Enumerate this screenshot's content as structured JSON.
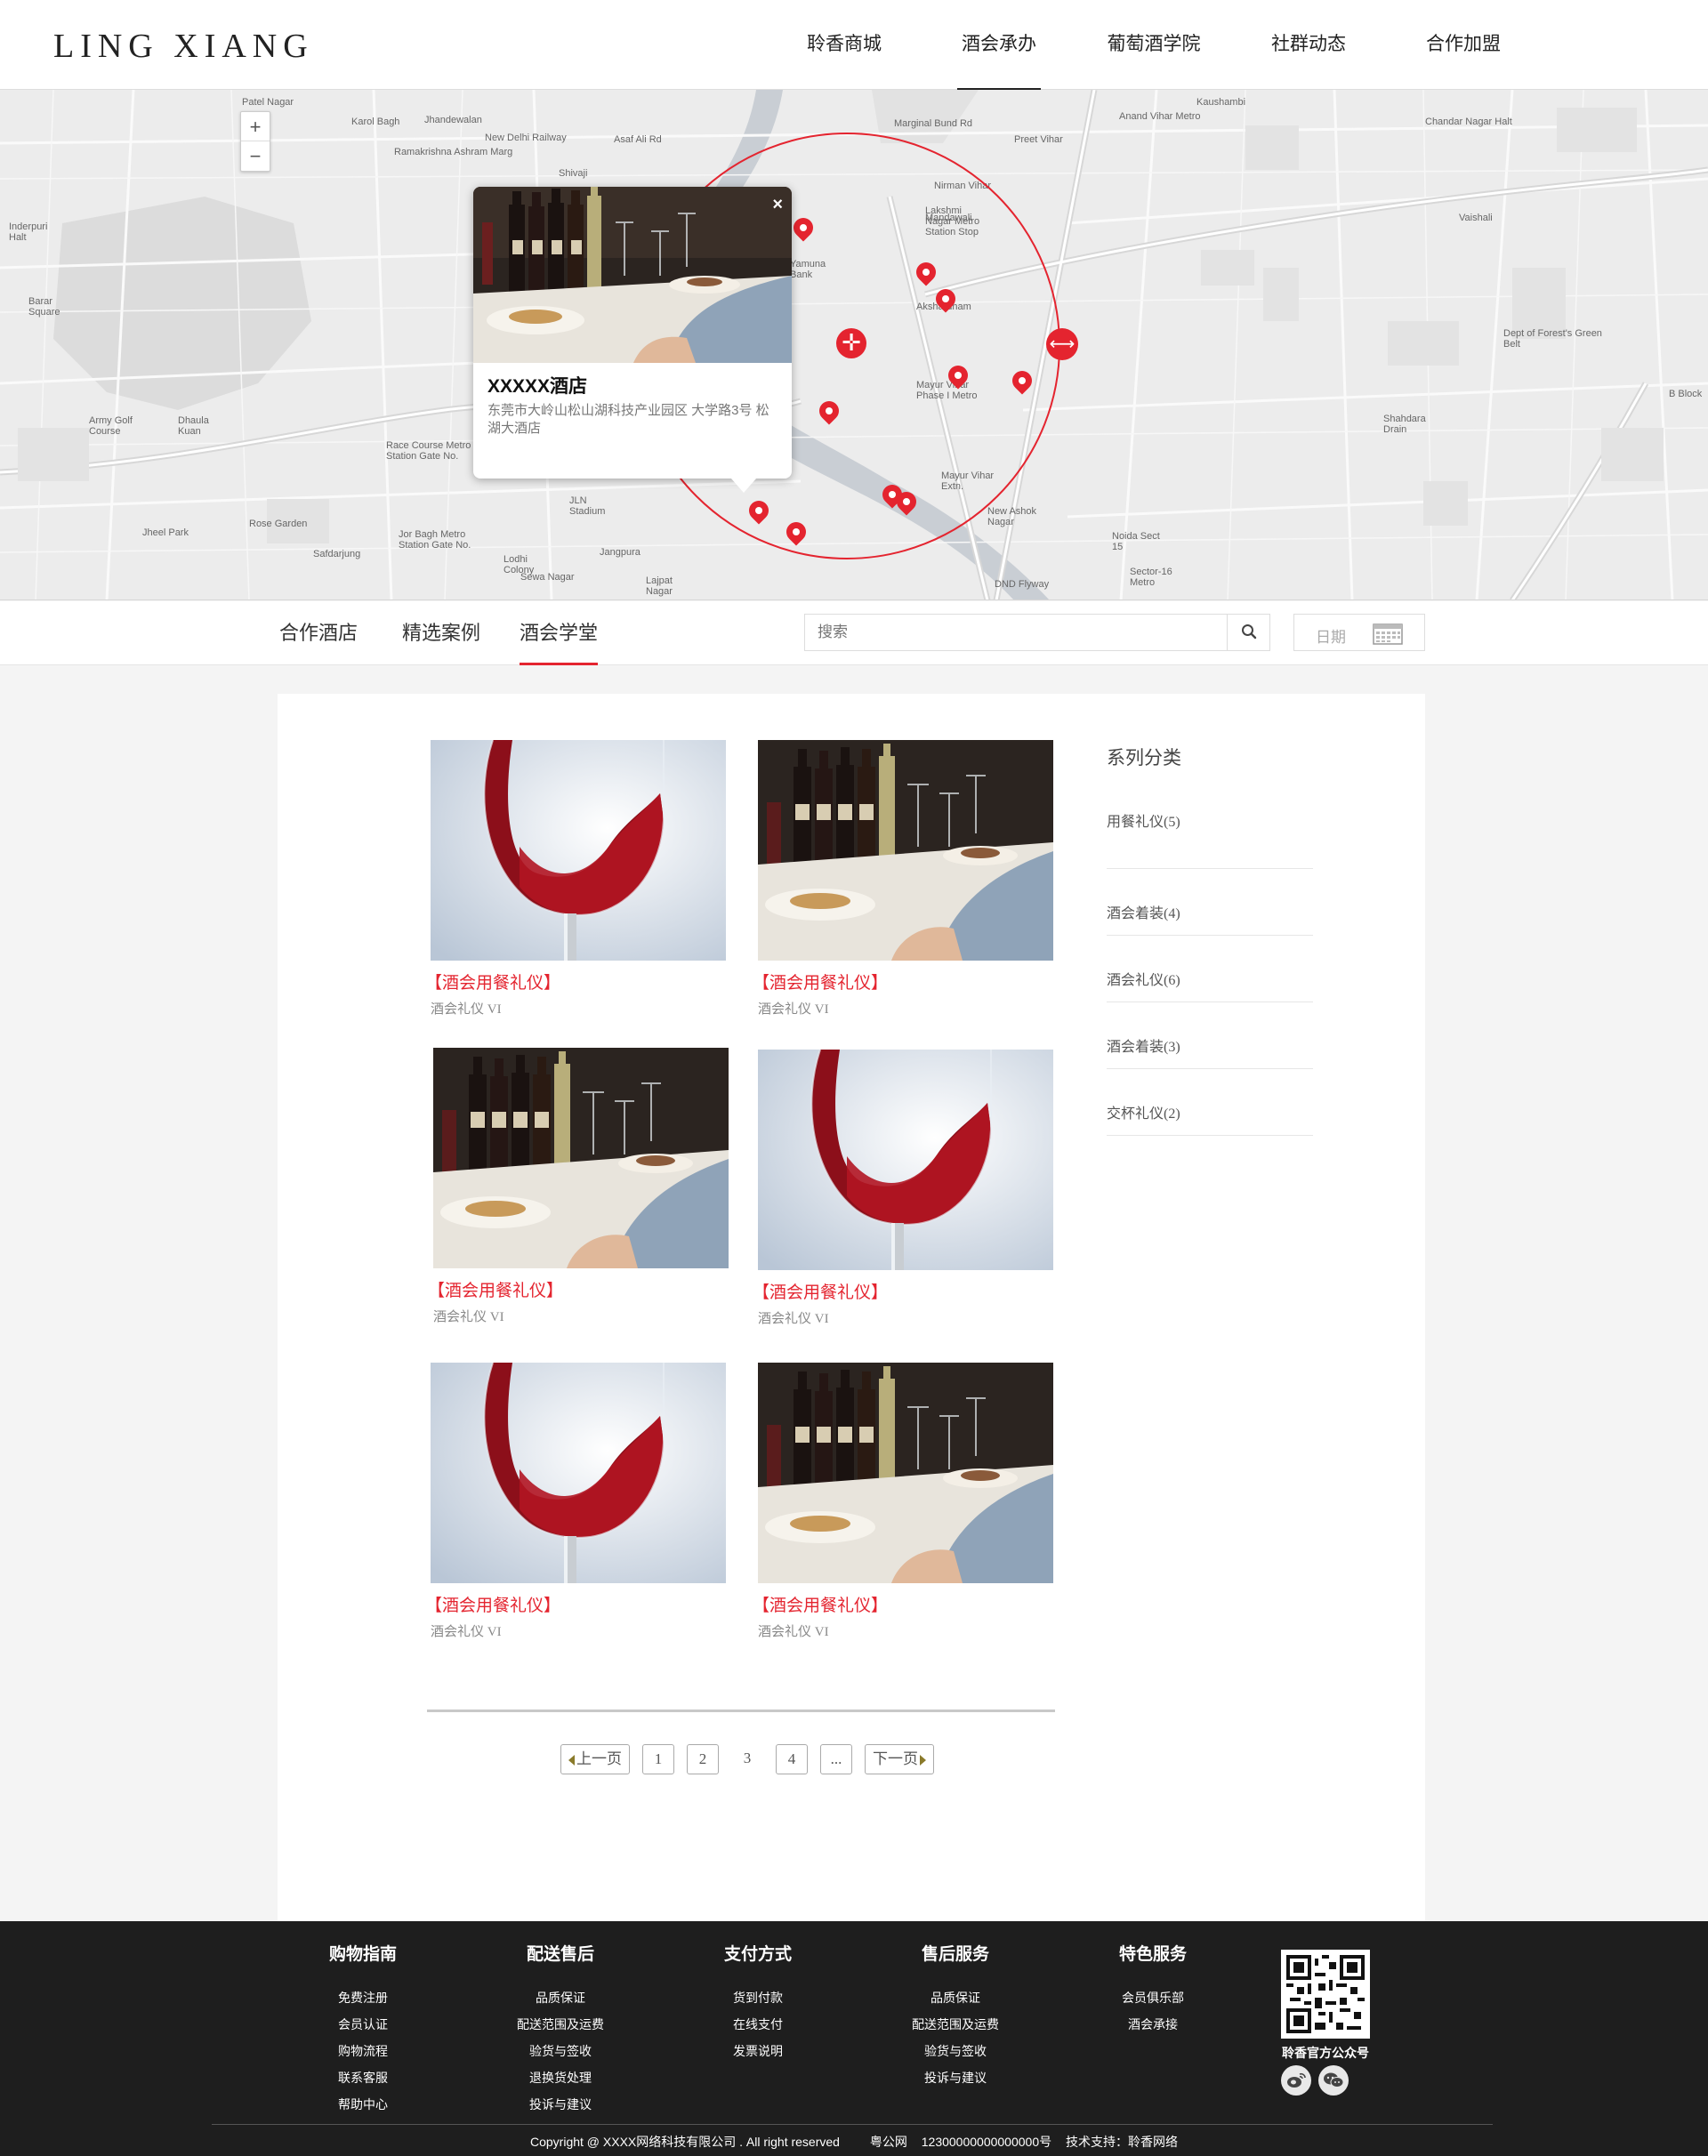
{
  "header": {
    "logo": "LING XIANG",
    "nav": [
      "聆香商城",
      "酒会承办",
      "葡萄酒学院",
      "社群动态",
      "合作加盟"
    ],
    "active_nav": "酒会承办"
  },
  "map": {
    "labels": {
      "patel_nagar": "Patel Nagar",
      "karol_bagh": "Karol Bagh",
      "jhandewalan": "Jhandewalan",
      "new_delhi_rail": "New Delhi Railway",
      "asaf_ali": "Asaf Ali Rd",
      "ramakrishna": "Ramakrishna Ashram Marg",
      "shivaji": "Shivaji",
      "marginal_bund": "Marginal Bund Rd",
      "preet_vihar": "Preet Vihar",
      "kaushambi": "Kaushambi",
      "anand_vihar": "Anand Vihar Metro",
      "chandar_nagar": "Chandar Nagar Halt",
      "nirman_vihar": "Nirman Vihar",
      "laxmi_nagar": "Lakshmi Nagar Metro Station Stop",
      "mandawali": "Mandawali",
      "akshardham": "Akshardham",
      "yamuna_bank": "Yamuna Bank",
      "mayur_vihar": "Mayur Vihar Phase I Metro",
      "mayur_ext": "Mayur Vihar Extn.",
      "new_ashok": "New Ashok Nagar",
      "noida": "Noida Sect 15",
      "sector16": "Sector-16 Metro",
      "inderpuri": "Inderpuri Halt",
      "barar": "Barar Square",
      "army_golf": "Army Golf Course",
      "dhaula": "Dhaula Kuan",
      "race_course": "Race Course Metro Station Gate No.",
      "rose_garden": "Rose Garden",
      "safdarjung": "Safdarjung",
      "jor_bagh": "Jor Bagh Metro Station Gate No.",
      "lodhi": "Lodhi Colony",
      "jangpura": "Jangpura",
      "lajpat": "Lajpat Nagar",
      "sewa_nagar": "Sewa Nagar",
      "jln": "JLN Stadium",
      "vaishali": "Vaishali",
      "b_block": "B Block",
      "shahdara": "Shahdara Drain",
      "green_belt": "Dept of Forest's Green Belt",
      "jheel_park": "Jheel Park",
      "dnd": "DND Flyway"
    },
    "popup": {
      "title": "XXXXX酒店",
      "address": "东莞市大岭山松山湖科技产业园区  大学路3号  松湖大酒店",
      "close": "×"
    },
    "zoom_in": "+",
    "zoom_out": "−"
  },
  "tabs": [
    "合作酒店",
    "精选案例",
    "酒会学堂"
  ],
  "active_tab": "酒会学堂",
  "search": {
    "placeholder": "搜索"
  },
  "date": {
    "label": "日期"
  },
  "cards": [
    {
      "title": "【酒会用餐礼仪】",
      "subtitle": "酒会礼仪  VI",
      "image": "wine-glass"
    },
    {
      "title": "【酒会用餐礼仪】",
      "subtitle": "酒会礼仪  VI",
      "image": "dinner"
    },
    {
      "title": "【酒会用餐礼仪】",
      "subtitle": "酒会礼仪  VI",
      "image": "dinner"
    },
    {
      "title": "【酒会用餐礼仪】",
      "subtitle": "酒会礼仪  VI",
      "image": "wine-glass"
    },
    {
      "title": "【酒会用餐礼仪】",
      "subtitle": "酒会礼仪  VI",
      "image": "wine-glass"
    },
    {
      "title": "【酒会用餐礼仪】",
      "subtitle": "酒会礼仪  VI",
      "image": "dinner"
    }
  ],
  "sidebar": {
    "title": "系列分类",
    "items": [
      "用餐礼仪(5)",
      "酒会着装(4)",
      "酒会礼仪(6)",
      "酒会着装(3)",
      "交杯礼仪(2)"
    ]
  },
  "pagination": {
    "prev": "上一页",
    "pages": [
      "1",
      "2",
      "3",
      "4",
      "..."
    ],
    "current": "3",
    "next": "下一页"
  },
  "footer": {
    "columns": [
      {
        "title": "购物指南",
        "links": [
          "免费注册",
          "会员认证",
          "购物流程",
          "联系客服",
          "帮助中心"
        ]
      },
      {
        "title": "配送售后",
        "links": [
          "品质保证",
          "配送范围及运费",
          "验货与签收",
          "退换货处理",
          "投诉与建议"
        ]
      },
      {
        "title": "支付方式",
        "links": [
          "货到付款",
          "在线支付",
          "发票说明"
        ]
      },
      {
        "title": "售后服务",
        "links": [
          "品质保证",
          "配送范围及运费",
          "验货与签收",
          "投诉与建议"
        ]
      },
      {
        "title": "特色服务",
        "links": [
          "会员俱乐部",
          "酒会承接"
        ]
      }
    ],
    "qr_label": "聆香官方公众号",
    "copyright": "Copyright @ XXXX网络科技有限公司 . All right reserved",
    "icp_label": "粤公网",
    "icp_number": "12300000000000000号",
    "tech_support": "技术支持：聆香网络"
  },
  "colors": {
    "accent": "#e4242f",
    "footer_bg": "#1e1e1e",
    "page_bg": "#f4f4f4"
  }
}
